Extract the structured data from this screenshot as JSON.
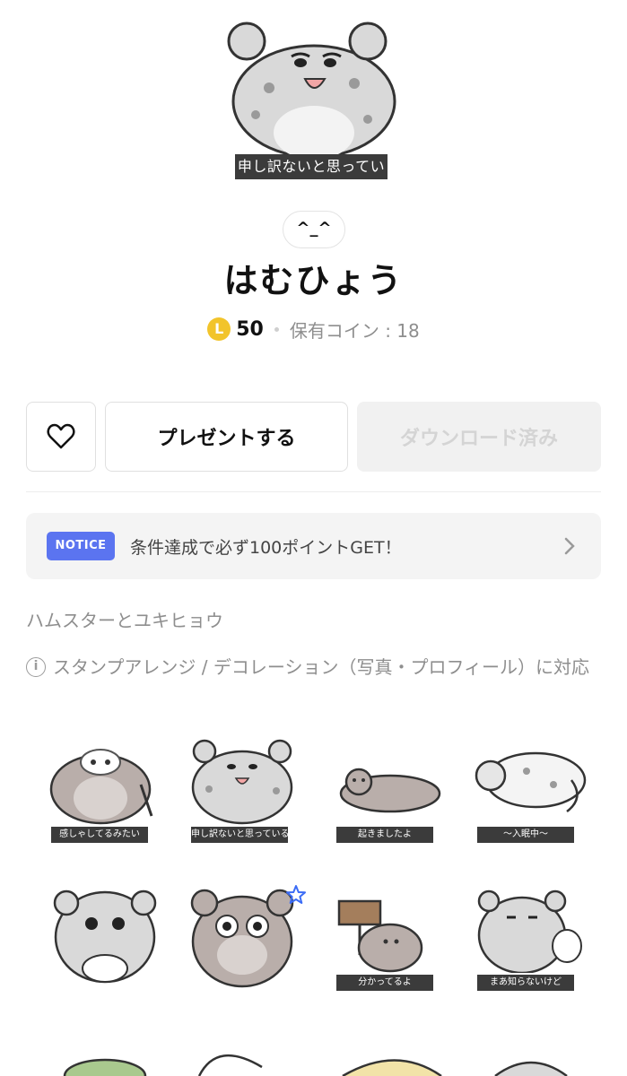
{
  "header": {
    "hero_caption": "申し訳ないと思っている"
  },
  "product": {
    "type_chip": "^_^",
    "title": "はむひょう",
    "coin_letter": "L",
    "price": "50",
    "owned_coins": "保有コイン : 18"
  },
  "actions": {
    "favorite_icon": "heart-icon",
    "present_label": "プレゼントする",
    "download_label": "ダウンロード済み"
  },
  "notice": {
    "badge": "NOTICE",
    "text": "条件達成で必ず100ポイントGET！"
  },
  "description": {
    "subtitle": "ハムスターとユキヒョウ",
    "support": "スタンプアレンジ / デコレーション（写真・プロフィール）に対応"
  },
  "stickers": [
    {
      "caption": "感しゃしてるみたい",
      "character": "hamster"
    },
    {
      "caption": "申し訳ないと思っている",
      "character": "leopard"
    },
    {
      "caption": "起きましたよ",
      "character": "hamster"
    },
    {
      "caption": "〜入眠中〜",
      "character": "leopard"
    },
    {
      "caption": "",
      "character": "leopard"
    },
    {
      "caption": "",
      "character": "hamster"
    },
    {
      "caption": "分かってるよ",
      "character": "hamster"
    },
    {
      "caption": "まあ知らないけど",
      "character": "leopard"
    }
  ],
  "colors": {
    "notice_badge": "#5b74f0",
    "coin": "#f2c42b",
    "star": "#3b6cf6"
  }
}
